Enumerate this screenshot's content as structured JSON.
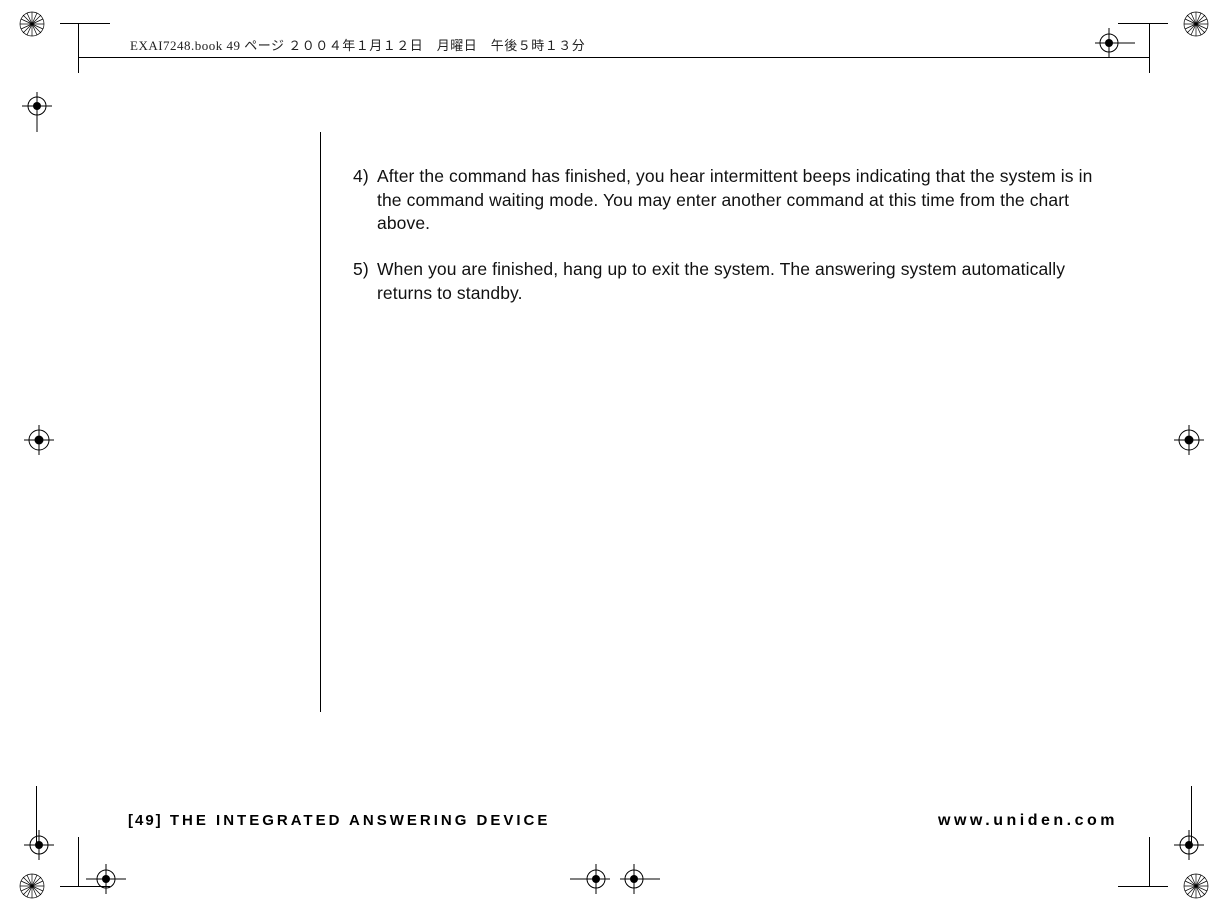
{
  "header": {
    "crop_text": "EXAI7248.book  49 ページ  ２００４年１月１２日　月曜日　午後５時１３分"
  },
  "body": {
    "items": [
      {
        "num": "4)",
        "text": "After the command has finished, you hear intermittent beeps indicating that the system is in the command waiting mode. You may enter another command at this time from the chart above."
      },
      {
        "num": "5)",
        "text": "When you are finished, hang up to exit the system. The answering system automatically returns to standby."
      }
    ]
  },
  "footer": {
    "page_no": "[49]",
    "section": "THE INTEGRATED ANSWERING DEVICE",
    "url": "www.uniden.com"
  }
}
